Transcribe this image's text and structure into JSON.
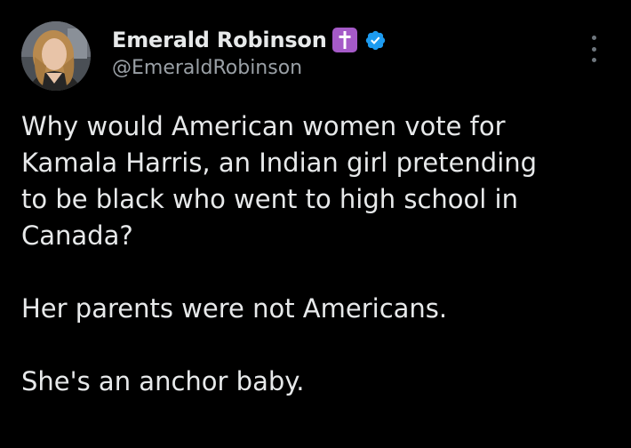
{
  "colors": {
    "background": "#000000",
    "text": "#e7e9ea",
    "handle": "#9aa0a6",
    "verified": "#1d9bf0",
    "cross_badge": "#a55ac8"
  },
  "author": {
    "display_name": "Emerald Robinson",
    "handle": "@EmeraldRobinson",
    "badges": [
      "latin-cross-icon",
      "verified-check-icon"
    ]
  },
  "tweet": {
    "paragraphs": [
      "Why would American women vote for\nKamala Harris, an Indian girl pretending\nto be black who went to high school in\nCanada?",
      "Her parents were not Americans.",
      "She's an anchor baby."
    ]
  },
  "menu": {
    "icon": "more-vertical-icon"
  }
}
